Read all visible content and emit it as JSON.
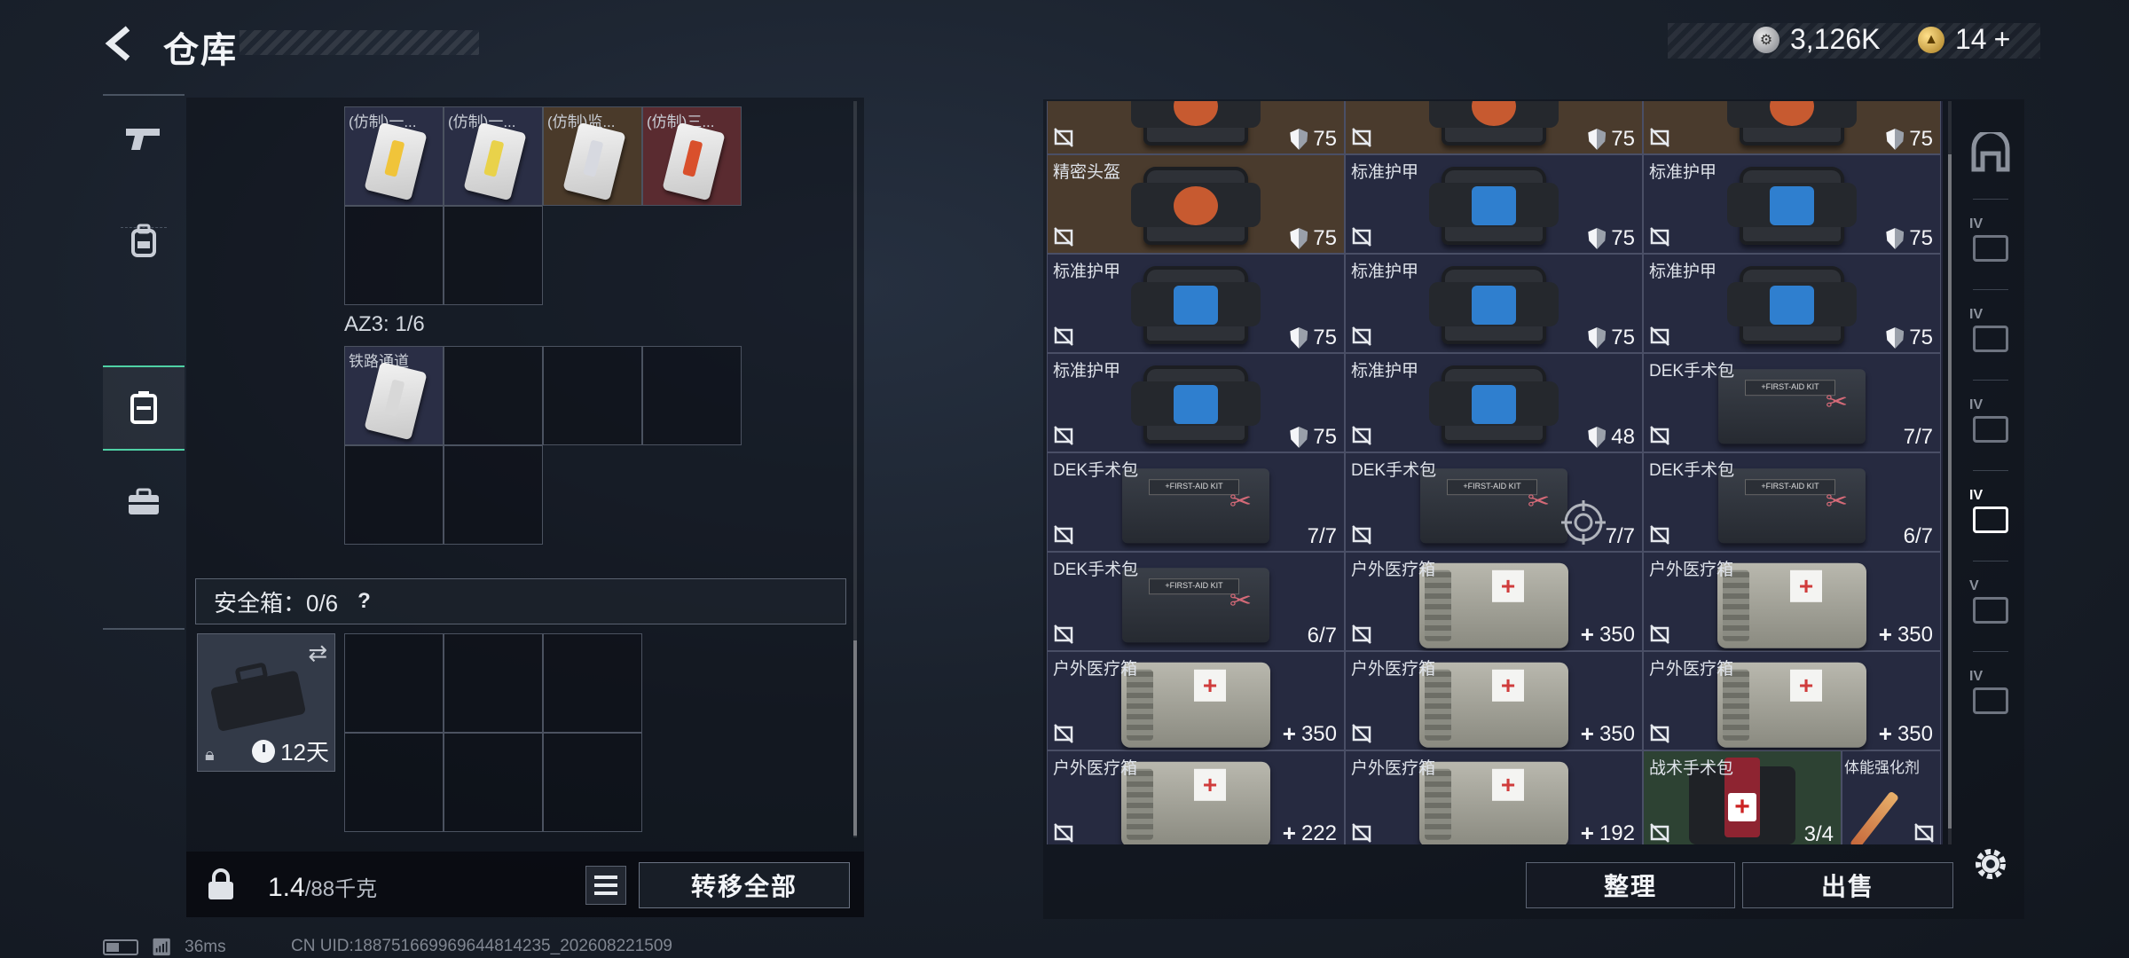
{
  "header": {
    "title": "仓库"
  },
  "currency": {
    "silver": "3,126K",
    "gold": "14",
    "gold_plus": "+"
  },
  "left_panel": {
    "top_items": [
      {
        "label": "(仿制)一...",
        "strip": "#f0c43a",
        "bg": "filled"
      },
      {
        "label": "(仿制)一...",
        "strip": "#e9d24a",
        "bg": "filled"
      },
      {
        "label": "(仿制)监...",
        "strip": "#d7d9e0",
        "bg": "orange"
      },
      {
        "label": "(仿制)三...",
        "strip": "#d9502c",
        "bg": "red"
      }
    ],
    "az3_label": "AZ3: 1/6",
    "az3_item": {
      "label": "铁路通道",
      "strip": "#d8d8d8"
    },
    "safe_label": "安全箱：0/6",
    "safe_help": "?",
    "safe_days": "12天",
    "weight_value": "1.4",
    "weight_unit": "/88千克",
    "transfer_all": "转移全部"
  },
  "status_bar": {
    "ping": "36ms",
    "uid": "CN UID:188751669969644814235_202608221509"
  },
  "right_grid": {
    "rows": [
      [
        {
          "name": "",
          "val": "75",
          "icon": "shield",
          "type": "armor-o",
          "bg": "orange"
        },
        {
          "name": "",
          "val": "75",
          "icon": "shield",
          "type": "armor-o",
          "bg": "orange"
        },
        {
          "name": "",
          "val": "75",
          "icon": "shield",
          "type": "armor-o",
          "bg": "orange"
        }
      ],
      [
        {
          "name": "精密头盔",
          "val": "75",
          "icon": "shield",
          "type": "armor-o",
          "bg": "orange"
        },
        {
          "name": "标准护甲",
          "val": "75",
          "icon": "shield",
          "type": "armor"
        },
        {
          "name": "标准护甲",
          "val": "75",
          "icon": "shield",
          "type": "armor"
        }
      ],
      [
        {
          "name": "标准护甲",
          "val": "75",
          "icon": "shield",
          "type": "armor"
        },
        {
          "name": "标准护甲",
          "val": "75",
          "icon": "shield",
          "type": "armor"
        },
        {
          "name": "标准护甲",
          "val": "75",
          "icon": "shield",
          "type": "armor"
        }
      ],
      [
        {
          "name": "标准护甲",
          "val": "75",
          "icon": "shield",
          "type": "armor"
        },
        {
          "name": "标准护甲",
          "val": "48",
          "icon": "shield",
          "type": "armor"
        },
        {
          "name": "DEK手术包",
          "val": "7/7",
          "icon": "",
          "type": "kit"
        }
      ],
      [
        {
          "name": "DEK手术包",
          "val": "7/7",
          "icon": "",
          "type": "kit"
        },
        {
          "name": "DEK手术包",
          "val": "7/7",
          "icon": "",
          "type": "kit"
        },
        {
          "name": "DEK手术包",
          "val": "6/7",
          "icon": "",
          "type": "kit"
        }
      ],
      [
        {
          "name": "DEK手术包",
          "val": "6/7",
          "icon": "",
          "type": "kit"
        },
        {
          "name": "户外医疗箱",
          "val": "350",
          "icon": "plus",
          "type": "med"
        },
        {
          "name": "户外医疗箱",
          "val": "350",
          "icon": "plus",
          "type": "med"
        }
      ],
      [
        {
          "name": "户外医疗箱",
          "val": "350",
          "icon": "plus",
          "type": "med"
        },
        {
          "name": "户外医疗箱",
          "val": "350",
          "icon": "plus",
          "type": "med"
        },
        {
          "name": "户外医疗箱",
          "val": "350",
          "icon": "plus",
          "type": "med"
        }
      ],
      [
        {
          "name": "户外医疗箱",
          "val": "222",
          "icon": "plus",
          "type": "med"
        },
        {
          "name": "户外医疗箱",
          "val": "192",
          "icon": "plus",
          "type": "med"
        },
        {
          "name": "战术手术包",
          "val": "3/4",
          "icon": "",
          "type": "tac",
          "bg": "green",
          "narrow": true
        },
        {
          "name": "体能强化剂",
          "val": "",
          "icon": "",
          "type": "syringe",
          "tiny": true
        }
      ]
    ]
  },
  "right_buttons": {
    "sort": "整理",
    "sell": "出售"
  },
  "filters": [
    "",
    "IV",
    "IV",
    "IV",
    "IV",
    "V",
    "IV"
  ]
}
